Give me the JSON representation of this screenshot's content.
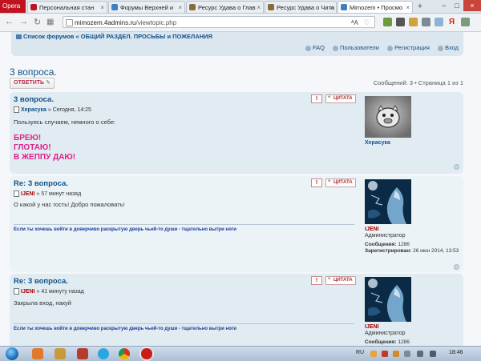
{
  "browser": {
    "opera_label": "Opera",
    "tabs": [
      {
        "label": "Персональная стан",
        "icon": "page-icon"
      },
      {
        "label": "Форумы Верхней и",
        "icon": "forum-icon"
      },
      {
        "label": "Ресурс Удава о Глав",
        "icon": "resource-icon"
      },
      {
        "label": "Ресурс Удава о Чита",
        "icon": "resource-icon"
      },
      {
        "label": "Mimozem • Просмо",
        "icon": "forum-icon"
      }
    ],
    "new_tab": "+",
    "url_host": "mimozem.4admins.ru",
    "url_path": "/viewtopic.php",
    "translate_label": "ᴬA",
    "window_controls": [
      "−",
      "□",
      "×"
    ]
  },
  "forum": {
    "breadcrumb": {
      "home": "Список форумов",
      "sep": " « ",
      "section": "ОБЩИЙ РАЗДЕЛ. ПРОСЬБЫ и ПОЖЕЛАНИЯ"
    },
    "links": {
      "faq": "FAQ",
      "users": "Пользователи",
      "register": "Регистрация",
      "login": "Вход"
    },
    "topic_title": "3 вопроса.",
    "reply_button": "ОТВЕТИТЬ",
    "page_info": "Сообщений: 3 • Страница 1 из 1",
    "quote_label": "ЦИТАТА",
    "report_label": "!",
    "posts": [
      {
        "title": "3 вопроса.",
        "author": "Херасука",
        "time": "Сегодня, 14:25",
        "body": "Пользуясь случаем, немного о себе:",
        "big_lines": [
          "БРЕЮ!",
          "ГЛОТАЮ!",
          "В ЖЕППУ ДАЮ!"
        ],
        "profile_name": "Херасука"
      },
      {
        "title": "Re: 3 вопроса.",
        "author": "IJENI",
        "time": "57 минут назад",
        "body": "О какой у нас гость! Добро пожаловать!",
        "signature": "Если ты хочешь войти в доверчиво раскрытую дверь чьей-то души - тщательно вытри ноги",
        "profile_name": "IJENI",
        "rank": "Администратор",
        "posts_label": "Сообщения:",
        "posts_count": "1286",
        "reg_label": "Зарегистрирован:",
        "reg_date": "26 июн 2014, 13:53"
      },
      {
        "title": "Re: 3 вопроса.",
        "author": "IJENI",
        "time": "41 минуту назад",
        "body": "Закрыла вход, накуй",
        "signature": "Если ты хочешь войти в доверчиво раскрытую дверь чьей-то души - тщательно вытри ноги",
        "profile_name": "IJENI",
        "rank": "Администратор",
        "posts_label": "Сообщения:",
        "posts_count": "1286"
      }
    ]
  },
  "taskbar": {
    "lang": "RU",
    "time": "18:46"
  },
  "colors": {
    "link": "#105289",
    "magenta": "#e0218a",
    "post_bg_dark": "#e1ebf2",
    "post_bg_light": "#ecf3f7",
    "opera_red": "#c1121f"
  }
}
